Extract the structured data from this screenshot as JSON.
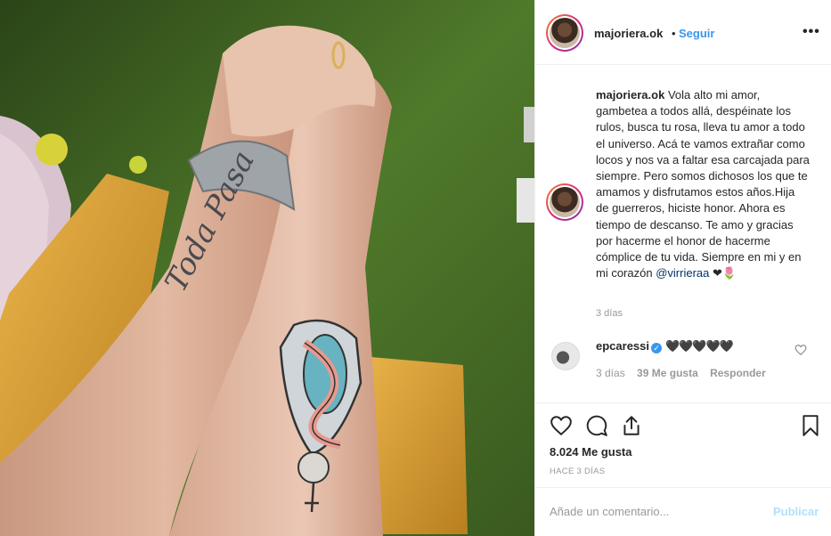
{
  "post": {
    "photo_alt": "",
    "header": {
      "username": "majoriera.ok",
      "separator": "•",
      "follow_label": "Seguir",
      "more_label": "•••"
    },
    "caption": {
      "username": "majoriera.ok",
      "text": "Vola alto mi amor, gambetea a todos allá, despéinate los rulos, busca tu rosa, lleva tu amor a todo el universo. Acá te vamos extrañar como locos y nos va a faltar esa carcajada para siempre. Pero somos dichosos los que te amamos y disfrutamos estos años.Hija de guerreros, hiciste honor. Ahora es tiempo de descanso. Te amo y gracias por hacerme el honor de hacerme cómplice de tu vida. Siempre en mi y en mi corazón",
      "mention": "@virrieraa",
      "emoji_tail": "❤🌷",
      "time": "3 días"
    },
    "comment": {
      "username": "epcaressi",
      "verified_mark": "✓",
      "text": "🖤🖤🖤🖤🖤",
      "time": "3 días",
      "likes": "39 Me gusta",
      "reply_label": "Responder"
    },
    "likes_count": "8.024 Me gusta",
    "posted_ago": "HACE 3 DÍAS",
    "add_comment_placeholder": "Añade un comentario...",
    "publish_label": "Publicar"
  },
  "colors": {
    "link_blue": "#3897f0",
    "publish_disabled": "#b2dffc",
    "muted_text": "#999999",
    "text": "#262626"
  },
  "icons": [
    "heart-icon",
    "comment-icon",
    "share-icon",
    "bookmark-icon",
    "heart-outline-small-icon",
    "verified-icon"
  ]
}
